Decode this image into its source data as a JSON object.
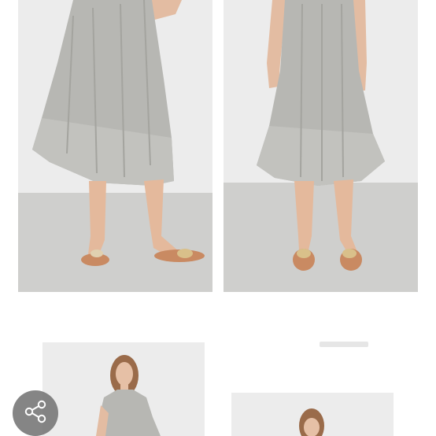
{
  "gallery": {
    "photos": [
      {
        "icon": "photo-dress-front-1"
      },
      {
        "icon": "photo-dress-front-2"
      },
      {
        "icon": "photo-model-portrait"
      },
      {
        "icon": "photo-model-portrait-2"
      }
    ]
  },
  "share": {
    "icon": "share-icon"
  },
  "colors": {
    "wall": "#e9eaea",
    "floor": "#c9c9c7",
    "dress": "#b5b5b0",
    "skin": "#e2b79a",
    "sandal": "#c98a62",
    "share_bg": "#7b7b7b"
  }
}
